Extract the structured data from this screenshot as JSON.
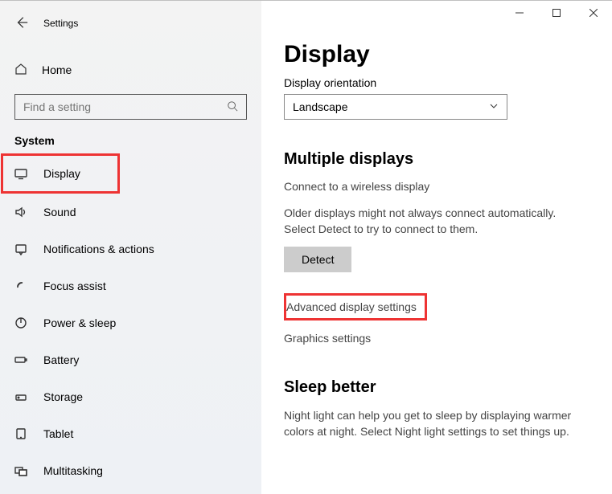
{
  "window": {
    "title": "Settings"
  },
  "sidebar": {
    "home": "Home",
    "search_placeholder": "Find a setting",
    "category": "System",
    "items": [
      {
        "label": "Display"
      },
      {
        "label": "Sound"
      },
      {
        "label": "Notifications & actions"
      },
      {
        "label": "Focus assist"
      },
      {
        "label": "Power & sleep"
      },
      {
        "label": "Battery"
      },
      {
        "label": "Storage"
      },
      {
        "label": "Tablet"
      },
      {
        "label": "Multitasking"
      }
    ]
  },
  "main": {
    "title": "Display",
    "orientation_label": "Display orientation",
    "orientation_value": "Landscape",
    "multiple_title": "Multiple displays",
    "connect_link": "Connect to a wireless display",
    "detect_text": "Older displays might not always connect automatically. Select Detect to try to connect to them.",
    "detect_button": "Detect",
    "advanced_link": "Advanced display settings",
    "graphics_link": "Graphics settings",
    "sleep_title": "Sleep better",
    "sleep_text": "Night light can help you get to sleep by displaying warmer colors at night. Select Night light settings to set things up."
  }
}
